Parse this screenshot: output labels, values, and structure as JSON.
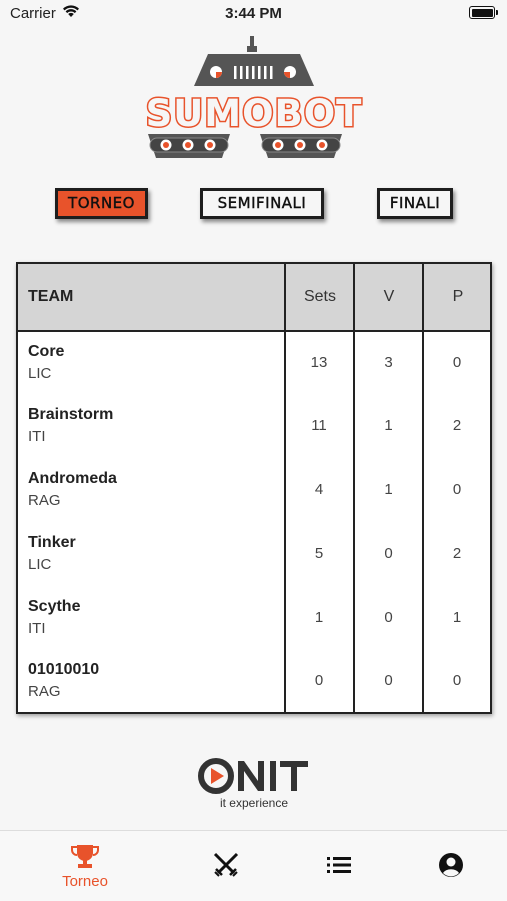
{
  "status": {
    "carrier": "Carrier",
    "time": "3:44 PM"
  },
  "logo": {
    "text": "SUMOBOT"
  },
  "tabs": [
    {
      "label": "TORNEO",
      "active": true
    },
    {
      "label": "SEMIFINALI",
      "active": false
    },
    {
      "label": "FINALI",
      "active": false
    }
  ],
  "table": {
    "headers": {
      "team": "TEAM",
      "sets": "Sets",
      "v": "V",
      "p": "P"
    },
    "rows": [
      {
        "name": "Core",
        "school": "LIC",
        "sets": "13",
        "v": "3",
        "p": "0"
      },
      {
        "name": "Brainstorm",
        "school": "ITI",
        "sets": "11",
        "v": "1",
        "p": "2"
      },
      {
        "name": "Andromeda",
        "school": "RAG",
        "sets": "4",
        "v": "1",
        "p": "0"
      },
      {
        "name": "Tinker",
        "school": "LIC",
        "sets": "5",
        "v": "0",
        "p": "2"
      },
      {
        "name": "Scythe",
        "school": "ITI",
        "sets": "1",
        "v": "0",
        "p": "1"
      },
      {
        "name": "01010010",
        "school": "RAG",
        "sets": "0",
        "v": "0",
        "p": "0"
      }
    ]
  },
  "brand": {
    "name": "ONIT",
    "tagline": "it experience"
  },
  "tabbar": {
    "items": [
      {
        "label": "Torneo",
        "icon": "trophy-icon",
        "active": true
      },
      {
        "label": "",
        "icon": "crossed-swords-icon",
        "active": false
      },
      {
        "label": "",
        "icon": "list-icon",
        "active": false
      },
      {
        "label": "",
        "icon": "user-icon",
        "active": false
      }
    ]
  },
  "colors": {
    "accent": "#e8532b",
    "header_bg": "#d5d5d5",
    "dark": "#1e1e1e"
  }
}
